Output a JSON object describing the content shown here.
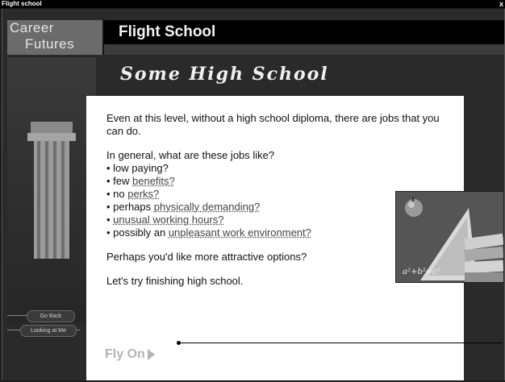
{
  "window": {
    "title": "Flight school",
    "close_label": "x"
  },
  "logo": {
    "line1": "Career",
    "line2": "Futures"
  },
  "header": {
    "title": "Flight School"
  },
  "section": {
    "heading": "Some High School"
  },
  "content": {
    "intro": "Even at this level, without a high school diploma, there are jobs that you can do.",
    "question": "In general, what are these jobs like?",
    "bullets": [
      {
        "prefix": "• low paying?",
        "link": ""
      },
      {
        "prefix": "• few ",
        "link": "benefits?"
      },
      {
        "prefix": "• no ",
        "link": "perks?"
      },
      {
        "prefix": "• perhaps ",
        "link": "physically demanding?"
      },
      {
        "prefix": "• ",
        "link": "unusual working hours?"
      },
      {
        "prefix": "• possibly an ",
        "link": "unpleasant work environment?"
      }
    ],
    "closing": "Perhaps you'd like more attractive options?",
    "cta": "Let's try finishing high school."
  },
  "navigation": {
    "fly_on": "Fly On",
    "go_back": "Go Back",
    "looking_at_me": "Looking at Me"
  },
  "photo": {
    "equation": "a²+b²=c²"
  }
}
